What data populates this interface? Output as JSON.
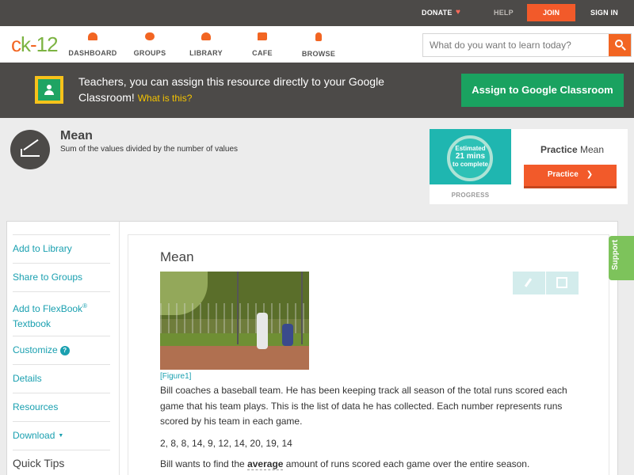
{
  "topbar": {
    "donate": "DONATE",
    "help": "HELP",
    "join": "JOIN",
    "signin": "SIGN IN"
  },
  "logo": {
    "c": "c",
    "k": "k",
    "dash": "-",
    "num": "12"
  },
  "nav": {
    "dashboard": "DASHBOARD",
    "groups": "GROUPS",
    "library": "LIBRARY",
    "cafe": "CAFE",
    "browse": "BROWSE"
  },
  "search": {
    "placeholder": "What do you want to learn today?"
  },
  "banner": {
    "text": "Teachers, you can assign this resource directly to your Google Classroom!",
    "what": "What is this?",
    "assign_button": "Assign to Google Classroom"
  },
  "concept": {
    "title": "Mean",
    "subtitle": "Sum of the values divided by the number of values"
  },
  "practice": {
    "estimated": "Estimated",
    "minutes": "21 mins",
    "to_complete": "to complete",
    "progress_label": "PROGRESS",
    "title_bold": "Practice",
    "title_rest": "Mean",
    "button": "Practice"
  },
  "sidebar": {
    "items": [
      {
        "label": "Add to Library"
      },
      {
        "label": "Share to Groups"
      },
      {
        "label": "Add to FlexBook",
        "sup": "®",
        "label2": "Textbook"
      },
      {
        "label": "Customize"
      },
      {
        "label": "Details"
      },
      {
        "label": "Resources"
      },
      {
        "label": "Download"
      }
    ],
    "quick_tips": "Quick Tips"
  },
  "article": {
    "title": "Mean",
    "figure_caption": "[Figure1]",
    "para1": "Bill coaches a baseball team. He has been keeping track all season of the total runs scored each game that his team plays. This is the list of data he has collected. Each number represents runs scored by his team in each game.",
    "data_list": "2, 8, 8, 14, 9, 12, 14, 20, 19, 14",
    "para3_before": "Bill wants to find the",
    "para3_term": "average",
    "para3_after": "amount of runs scored each game over the entire season."
  },
  "support": "Support",
  "colors": {
    "brand_orange": "#f26522",
    "brand_green": "#7cb342",
    "teal_link": "#1aa0b0",
    "google_green": "#1aa260",
    "dark_bar": "#4c4a48"
  }
}
